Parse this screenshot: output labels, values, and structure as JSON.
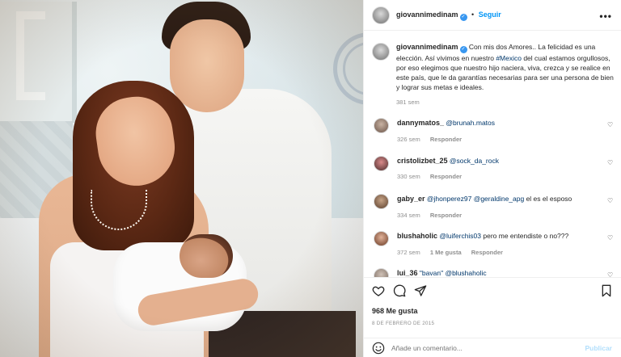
{
  "post": {
    "author": "giovannimedinam",
    "follow_label": "Seguir",
    "more_label": "•••",
    "caption_part1": "Con mis dos Amores.. La felicidad es una elección. Así vivimos en nuestro ",
    "caption_hashtag": "#Mexico",
    "caption_part2": " del cual estamos orgullosos, por eso elegimos que nuestro hijo naciera, viva, crezca y se realice en este país, que le da garantías necesarias para ser una persona de bien y lograr sus metas e ideales.",
    "caption_time": "381 sem"
  },
  "comments": [
    {
      "user": "dannymatos_",
      "mention": "@brunah.matos",
      "text": "",
      "time": "326 sem",
      "likes": "",
      "reply": "Responder"
    },
    {
      "user": "cristolizbet_25",
      "mention": "@sock_da_rock",
      "text": "",
      "time": "330 sem",
      "likes": "",
      "reply": "Responder"
    },
    {
      "user": "gaby_er",
      "mention": "@jhonperez97",
      "mention2": "@geraldine_apg",
      "text": " el es el esposo",
      "time": "334 sem",
      "likes": "",
      "reply": "Responder"
    },
    {
      "user": "blushaholic",
      "mention": "@luiferchis03",
      "text": " pero me entendiste o no???",
      "time": "372 sem",
      "likes": "1 Me gusta",
      "reply": "Responder"
    },
    {
      "user": "lui_36",
      "mention": "\"bavan\" @blushaholic",
      "text": "",
      "time": "",
      "likes": "",
      "reply": ""
    }
  ],
  "footer": {
    "likes": "968 Me gusta",
    "date": "8 DE FEBRERO DE 2015",
    "comment_placeholder": "Añade un comentario...",
    "publish": "Publicar"
  },
  "icons": {
    "like": "heart-icon",
    "comment": "comment-icon",
    "share": "send-icon",
    "save": "bookmark-icon",
    "emoji": "emoji-icon",
    "verified": "verified-badge-icon"
  },
  "colors": {
    "link": "#0095f6",
    "hashtag": "#00376b",
    "muted": "#8e8e8e",
    "text": "#262626",
    "verified": "#3897f0"
  }
}
